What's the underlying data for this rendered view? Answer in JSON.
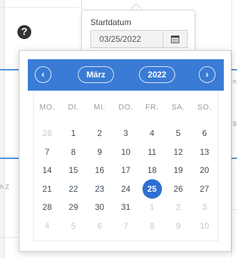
{
  "start_date": {
    "label": "Startdatum",
    "value": "03/25/2022"
  },
  "calendar": {
    "month": "März",
    "year": "2022",
    "prev_glyph": "‹",
    "next_glyph": "›",
    "weekdays": [
      "MO.",
      "DI.",
      "MI.",
      "DO.",
      "FR.",
      "SA.",
      "SO."
    ],
    "weeks": [
      [
        {
          "d": "28",
          "m": true
        },
        {
          "d": "1"
        },
        {
          "d": "2"
        },
        {
          "d": "3"
        },
        {
          "d": "4"
        },
        {
          "d": "5"
        },
        {
          "d": "6"
        }
      ],
      [
        {
          "d": "7"
        },
        {
          "d": "8"
        },
        {
          "d": "9"
        },
        {
          "d": "10"
        },
        {
          "d": "11"
        },
        {
          "d": "12"
        },
        {
          "d": "13"
        }
      ],
      [
        {
          "d": "14"
        },
        {
          "d": "15"
        },
        {
          "d": "16"
        },
        {
          "d": "17"
        },
        {
          "d": "18"
        },
        {
          "d": "19"
        },
        {
          "d": "20"
        }
      ],
      [
        {
          "d": "21"
        },
        {
          "d": "22"
        },
        {
          "d": "23"
        },
        {
          "d": "24"
        },
        {
          "d": "25",
          "sel": true
        },
        {
          "d": "26"
        },
        {
          "d": "27"
        }
      ],
      [
        {
          "d": "28"
        },
        {
          "d": "29"
        },
        {
          "d": "30"
        },
        {
          "d": "31"
        },
        {
          "d": "1",
          "m": true
        },
        {
          "d": "2",
          "m": true
        },
        {
          "d": "3",
          "m": true
        }
      ],
      [
        {
          "d": "4",
          "m": true
        },
        {
          "d": "5",
          "m": true
        },
        {
          "d": "6",
          "m": true
        },
        {
          "d": "7",
          "m": true
        },
        {
          "d": "8",
          "m": true
        },
        {
          "d": "9",
          "m": true
        },
        {
          "d": "10",
          "m": true
        }
      ]
    ]
  },
  "background": {
    "frag_left": "h Z",
    "frag_right_1": "n",
    "frag_right_2": "g"
  },
  "icons": {
    "help": "?"
  },
  "colors": {
    "header_blue": "#3a7bd5",
    "selected_day": "#2f6fd1"
  }
}
